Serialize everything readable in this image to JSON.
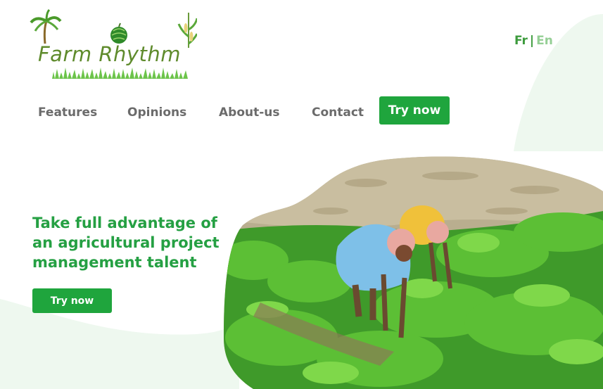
{
  "brand": {
    "name": "Farm Rhythm"
  },
  "language": {
    "options": [
      "Fr",
      "En"
    ],
    "separator": "|",
    "active": "Fr"
  },
  "nav": {
    "items": [
      {
        "label": "Features"
      },
      {
        "label": "Opinions"
      },
      {
        "label": "About-us"
      },
      {
        "label": "Contact"
      }
    ],
    "cta_label": "Try now"
  },
  "hero": {
    "title_lines": [
      "Take full advantage of",
      "an agricultural project",
      "management talent"
    ],
    "cta_label": "Try now"
  },
  "colors": {
    "accent": "#1fa53d",
    "heading": "#25a043",
    "nav_text": "#6b6b6b",
    "blob": "#eef8ef"
  },
  "icons": [
    "palm-tree-icon",
    "watermelon-icon",
    "corn-plant-icon",
    "grass-icon"
  ]
}
